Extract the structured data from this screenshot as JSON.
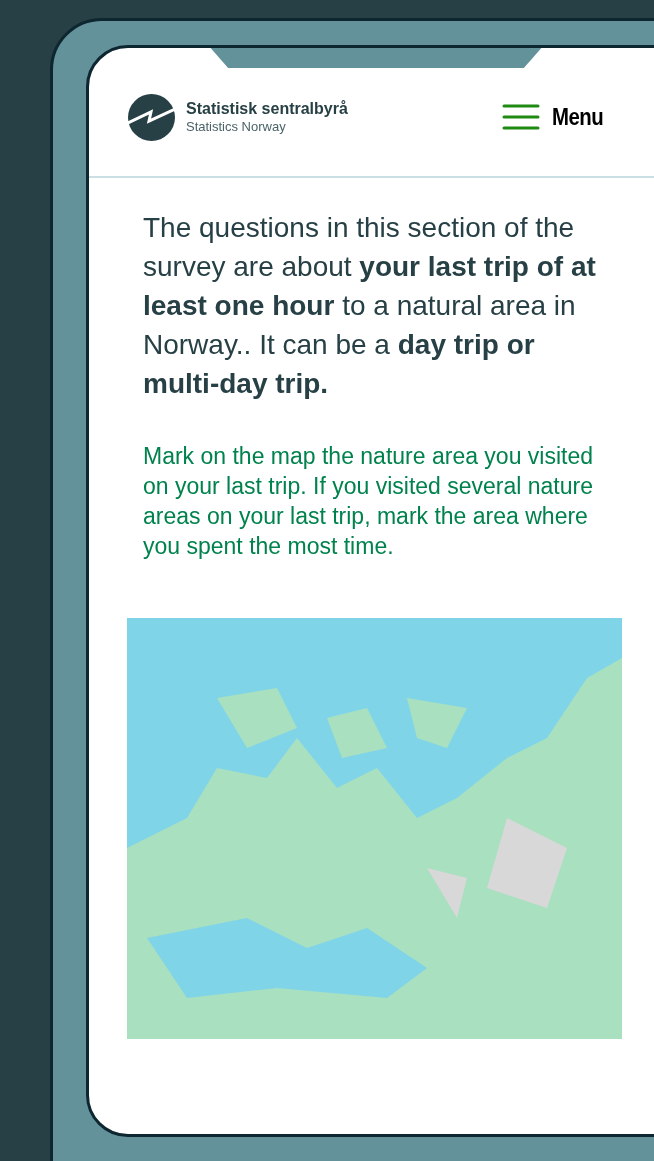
{
  "header": {
    "title": "Statistisk sentralbyrå",
    "subtitle": "Statistics Norway",
    "menu_label": "Menu"
  },
  "intro": "The questions in this section of the survey are about **your last trip of at least one hour** to a natural area in Norway.. It can be a **day trip or multi-day trip.**",
  "instruction": "Mark on the map the nature area you visited on your last trip. If you visited several nature areas on your last trip, mark the area where you spent the most time."
}
